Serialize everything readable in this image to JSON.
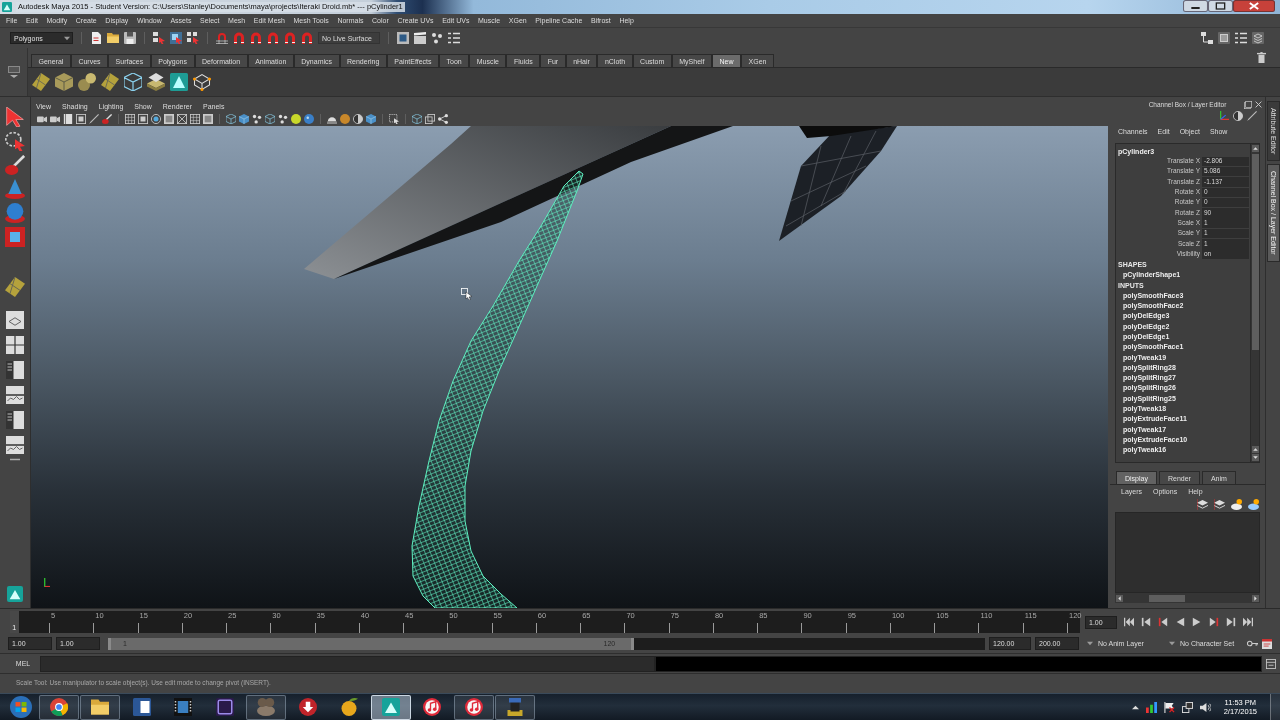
{
  "window": {
    "title": "Autodesk Maya 2015 - Student Version: C:\\Users\\Stanley\\Documents\\maya\\projects\\Iteraki Droid.mb* --- pCylinder1"
  },
  "menu_bar": [
    "File",
    "Edit",
    "Modify",
    "Create",
    "Display",
    "Window",
    "Assets",
    "Select",
    "Mesh",
    "Edit Mesh",
    "Mesh Tools",
    "Normals",
    "Color",
    "Create UVs",
    "Edit UVs",
    "Muscle",
    "XGen",
    "Pipeline Cache",
    "Bifrost",
    "Help"
  ],
  "status_line": {
    "menu_set": "Polygons",
    "live_surface": "No Live Surface"
  },
  "shelf": {
    "tabs": [
      {
        "label": "General",
        "selected": false
      },
      {
        "label": "Curves",
        "selected": false
      },
      {
        "label": "Surfaces",
        "selected": false
      },
      {
        "label": "Polygons",
        "selected": false
      },
      {
        "label": "Deformation",
        "selected": false
      },
      {
        "label": "Animation",
        "selected": false
      },
      {
        "label": "Dynamics",
        "selected": false
      },
      {
        "label": "Rendering",
        "selected": false
      },
      {
        "label": "PaintEffects",
        "selected": false
      },
      {
        "label": "Toon",
        "selected": false
      },
      {
        "label": "Muscle",
        "selected": false
      },
      {
        "label": "Fluids",
        "selected": false
      },
      {
        "label": "Fur",
        "selected": false
      },
      {
        "label": "nHair",
        "selected": false
      },
      {
        "label": "nCloth",
        "selected": false
      },
      {
        "label": "Custom",
        "selected": false
      },
      {
        "label": "MyShelf",
        "selected": false
      },
      {
        "label": "New",
        "selected": true
      },
      {
        "label": "XGen",
        "selected": false
      }
    ]
  },
  "viewport": {
    "menu": [
      "View",
      "Shading",
      "Lighting",
      "Show",
      "Renderer",
      "Panels"
    ]
  },
  "channel_box": {
    "title": "Channel Box / Layer Editor",
    "menu": [
      "Channels",
      "Edit",
      "Object",
      "Show"
    ],
    "object": "pCylinder3",
    "attributes": [
      {
        "name": "Translate X",
        "value": "-2.806"
      },
      {
        "name": "Translate Y",
        "value": "5.086"
      },
      {
        "name": "Translate Z",
        "value": "-1.137"
      },
      {
        "name": "Rotate X",
        "value": "0"
      },
      {
        "name": "Rotate Y",
        "value": "0"
      },
      {
        "name": "Rotate Z",
        "value": "90"
      },
      {
        "name": "Scale X",
        "value": "1"
      },
      {
        "name": "Scale Y",
        "value": "1"
      },
      {
        "name": "Scale Z",
        "value": "1"
      },
      {
        "name": "Visibility",
        "value": "on"
      }
    ],
    "shapes_heading": "SHAPES",
    "shapes": [
      "pCylinderShape1"
    ],
    "inputs_heading": "INPUTS",
    "inputs": [
      "polySmoothFace3",
      "polySmoothFace2",
      "polyDelEdge3",
      "polyDelEdge2",
      "polyDelEdge1",
      "polySmoothFace1",
      "polyTweak19",
      "polySplitRing28",
      "polySplitRing27",
      "polySplitRing26",
      "polySplitRing25",
      "polyTweak18",
      "polyExtrudeFace11",
      "polyTweak17",
      "polyExtrudeFace10",
      "polyTweak16"
    ]
  },
  "side_tabs": [
    {
      "label": "Attribute Editor",
      "selected": false
    },
    {
      "label": "Channel Box / Layer Editor",
      "selected": true
    }
  ],
  "layer_editor": {
    "tabs": [
      {
        "label": "Display",
        "selected": true
      },
      {
        "label": "Render",
        "selected": false
      },
      {
        "label": "Anim",
        "selected": false
      }
    ],
    "menu": [
      "Layers",
      "Options",
      "Help"
    ]
  },
  "time_slider": {
    "current_frame": "1",
    "level": 0,
    "ticks": [
      "5",
      "10",
      "15",
      "20",
      "25",
      "30",
      "35",
      "40",
      "45",
      "50",
      "55",
      "60",
      "65",
      "70",
      "75",
      "80",
      "85",
      "90",
      "95",
      "100",
      "105",
      "110",
      "115",
      "120"
    ],
    "frame_field": "1.00"
  },
  "range_slider": {
    "start_field": "1.00",
    "range_start_field": "1.00",
    "range_start": "1",
    "range_end": "120",
    "level": 0.6,
    "range_end_field": "120.00",
    "end_field": "200.00",
    "anim_layer": "No Anim Layer",
    "character_set": "No Character Set"
  },
  "command_line": {
    "language": "MEL"
  },
  "help_line": "Scale Tool: Use manipulator to scale object(s). Use edit mode to change pivot (INSERT).",
  "taskbar": {
    "apps": [
      {
        "running": true,
        "selected": false
      },
      {
        "running": true,
        "selected": false
      },
      {
        "running": false,
        "selected": false
      },
      {
        "running": false,
        "selected": false
      },
      {
        "running": false,
        "selected": false
      },
      {
        "running": true,
        "selected": false
      },
      {
        "running": false,
        "selected": false
      },
      {
        "running": false,
        "selected": false
      },
      {
        "running": true,
        "selected": true
      },
      {
        "running": false,
        "selected": false
      },
      {
        "running": true,
        "selected": false
      },
      {
        "running": true,
        "selected": false
      }
    ],
    "clock": {
      "time": "11:53 PM",
      "date": "2/17/2015"
    }
  }
}
